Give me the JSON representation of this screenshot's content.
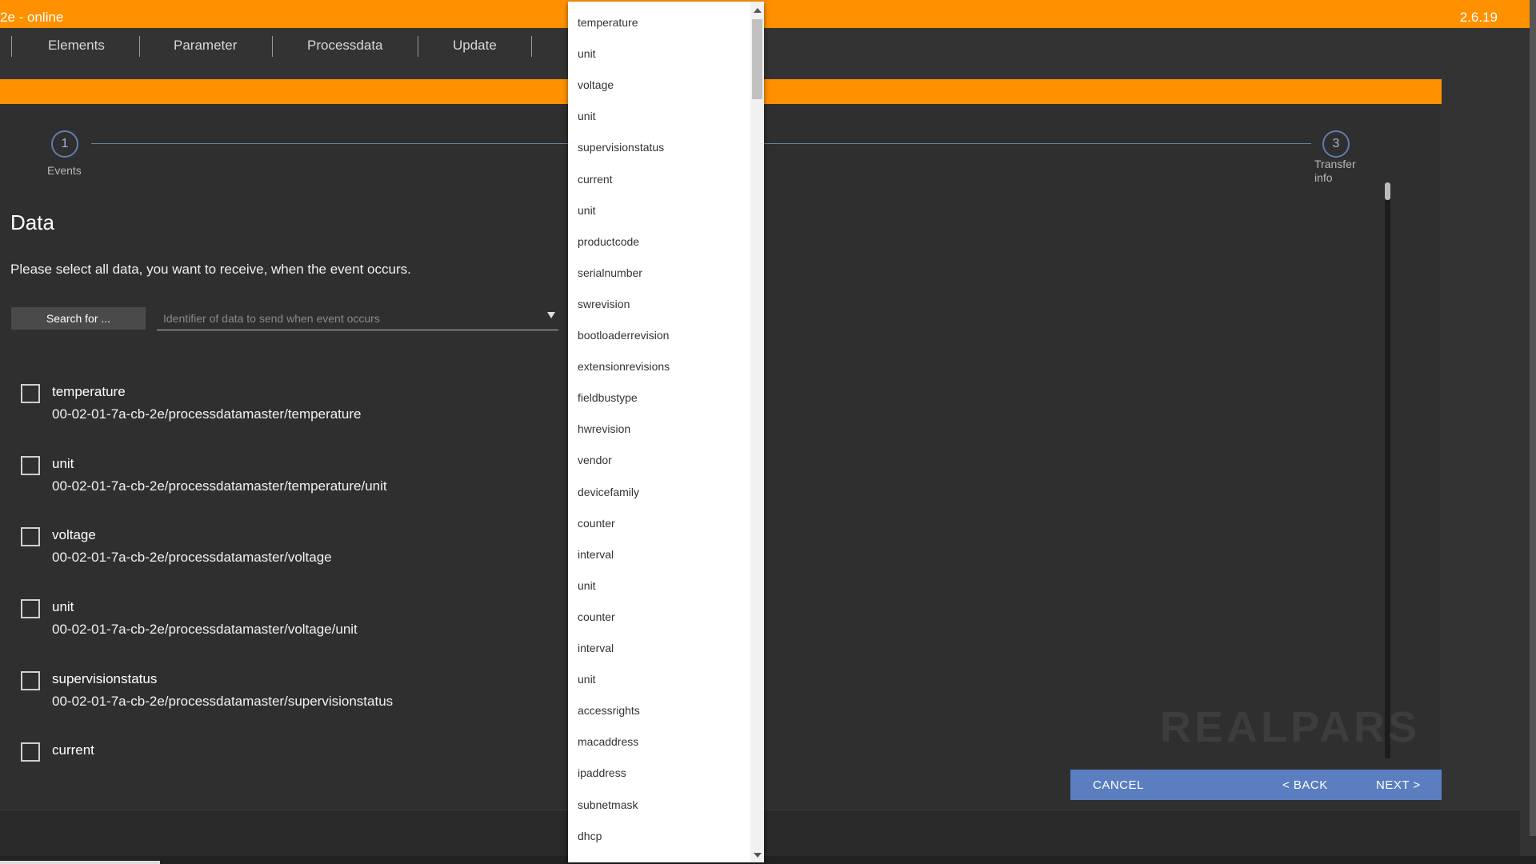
{
  "app": {
    "title": "2e - online",
    "version": "2.6.19"
  },
  "nav": {
    "items": [
      "Elements",
      "Parameter",
      "Processdata",
      "Update"
    ]
  },
  "stepper": {
    "steps": [
      {
        "number": "1",
        "label": "Events"
      },
      {
        "number": "3",
        "label": "Transfer info"
      }
    ]
  },
  "data_section": {
    "title": "Data",
    "description": "Please select all data, you want to receive, when the event occurs.",
    "search_button": "Search for ...",
    "search_placeholder": "Identifier of data to send when event occurs",
    "rows": [
      {
        "name": "temperature",
        "path": "00-02-01-7a-cb-2e/processdatamaster/temperature",
        "checked": false
      },
      {
        "name": "unit",
        "path": "00-02-01-7a-cb-2e/processdatamaster/temperature/unit",
        "checked": false
      },
      {
        "name": "voltage",
        "path": "00-02-01-7a-cb-2e/processdatamaster/voltage",
        "checked": false
      },
      {
        "name": "unit",
        "path": "00-02-01-7a-cb-2e/processdatamaster/voltage/unit",
        "checked": false
      },
      {
        "name": "supervisionstatus",
        "path": "00-02-01-7a-cb-2e/processdatamaster/supervisionstatus",
        "checked": false
      },
      {
        "name": "current",
        "path": "",
        "checked": false
      }
    ]
  },
  "dropdown": {
    "items": [
      "temperature",
      "unit",
      "voltage",
      "unit",
      "supervisionstatus",
      "current",
      "unit",
      "productcode",
      "serialnumber",
      "swrevision",
      "bootloaderrevision",
      "extensionrevisions",
      "fieldbustype",
      "hwrevision",
      "vendor",
      "devicefamily",
      "counter",
      "interval",
      "unit",
      "counter",
      "interval",
      "unit",
      "accessrights",
      "macaddress",
      "ipaddress",
      "subnetmask",
      "dhcp"
    ]
  },
  "actions": {
    "cancel": "CANCEL",
    "back": "< BACK",
    "next": "NEXT >"
  },
  "watermark": "REALPARS",
  "colors": {
    "accent": "#ff9100",
    "action_bar": "#5b7ec0",
    "background": "#333333"
  }
}
